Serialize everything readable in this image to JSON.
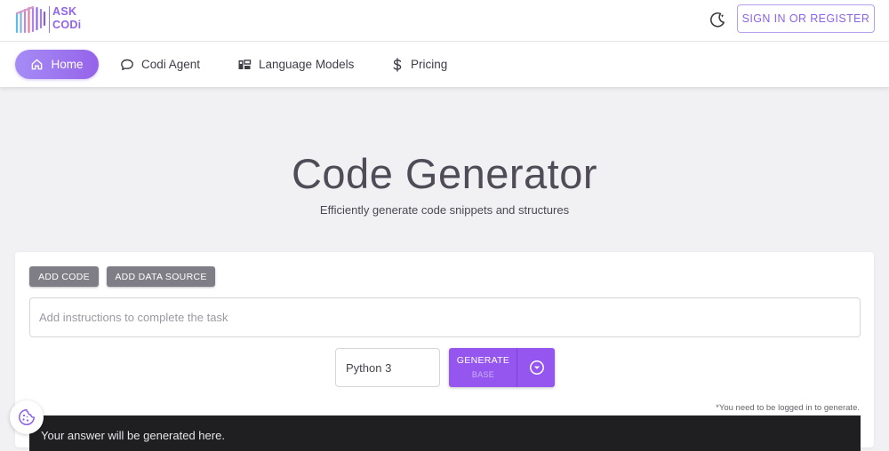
{
  "header": {
    "logo_line1": "ASK",
    "logo_line2": "CODi",
    "theme_toggle_icon": "moon-icon",
    "signin_label": "SIGN IN OR REGISTER"
  },
  "nav": {
    "items": [
      {
        "label": "Home",
        "icon": "home-icon",
        "active": true
      },
      {
        "label": "Codi Agent",
        "icon": "chat-bubble-icon"
      },
      {
        "label": "Language Models",
        "icon": "models-icon"
      },
      {
        "label": "Pricing",
        "icon": "dollar-icon"
      }
    ]
  },
  "hero": {
    "title": "Code Generator",
    "subtitle": "Efficiently generate code snippets and structures"
  },
  "form": {
    "add_code_label": "ADD CODE",
    "add_data_source_label": "ADD DATA SOURCE",
    "instructions_placeholder": "Add instructions to complete the task",
    "language_value": "Python 3",
    "generate_label": "GENERATE",
    "generate_mode": "BASE",
    "login_note": "*You need to be logged in to generate.",
    "answer_placeholder": "Your answer will be generated here."
  },
  "colors": {
    "accent": "#9556ef",
    "accent_light": "#a68cf6",
    "answer_bg": "#1f1f21",
    "page_bg": "#f1f1f3"
  },
  "floating": {
    "cookie_icon": "cookie-icon"
  }
}
